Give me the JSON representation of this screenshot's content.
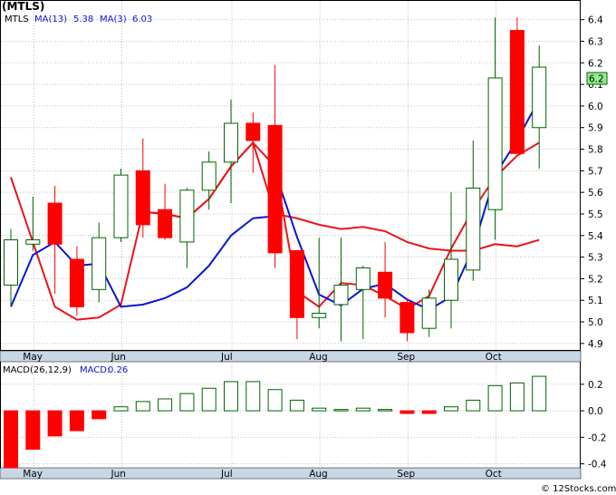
{
  "header": {
    "ticker": "(MTLS)"
  },
  "legend": {
    "symbol": "MTLS",
    "ma13_label": "MA(13)",
    "ma13_value": "5.38",
    "ma3_label": "MA(3)",
    "ma3_value": "6.03",
    "macd_params": "MACD(26,12,9)",
    "macd_label": "MACD:",
    "macd_value": "0.26"
  },
  "last_price_tag": "6.2",
  "credit": "© 12Stocks.com",
  "colors": {
    "up": "#006400",
    "down": "#ff0000",
    "ma13": "#e8151b",
    "ma3": "#0a14d2",
    "axis_band": "#c8d7e6",
    "price_tag": "#90ee90"
  },
  "chart_data": {
    "type": "candlestick",
    "timeframe": "weekly",
    "price_axis": {
      "ylim": [
        4.87,
        6.47
      ],
      "ticks": [
        "4.9",
        "5.0",
        "5.1",
        "5.2",
        "5.3",
        "5.4",
        "5.5",
        "5.6",
        "5.7",
        "5.8",
        "5.9",
        "6.0",
        "6.1",
        "6.2",
        "6.3",
        "6.4"
      ]
    },
    "macd_axis": {
      "ylim": [
        -0.43,
        0.37
      ],
      "ticks": [
        "0.2",
        "0.0",
        "-0.2",
        "-0.4"
      ]
    },
    "months": [
      "May",
      "Jun",
      "Jul",
      "Aug",
      "Sep",
      "Oct"
    ],
    "month_week_index": [
      1,
      5,
      10,
      14,
      18,
      22
    ],
    "candles": [
      {
        "o": 5.17,
        "h": 5.43,
        "l": 5.08,
        "c": 5.38
      },
      {
        "o": 5.36,
        "h": 5.58,
        "l": 5.33,
        "c": 5.38
      },
      {
        "o": 5.55,
        "h": 5.63,
        "l": 5.13,
        "c": 5.36
      },
      {
        "o": 5.29,
        "h": 5.35,
        "l": 5.03,
        "c": 5.07
      },
      {
        "o": 5.15,
        "h": 5.46,
        "l": 5.09,
        "c": 5.39
      },
      {
        "o": 5.39,
        "h": 5.71,
        "l": 5.37,
        "c": 5.68
      },
      {
        "o": 5.7,
        "h": 5.85,
        "l": 5.39,
        "c": 5.45
      },
      {
        "o": 5.52,
        "h": 5.64,
        "l": 5.38,
        "c": 5.39
      },
      {
        "o": 5.37,
        "h": 5.62,
        "l": 5.25,
        "c": 5.61
      },
      {
        "o": 5.61,
        "h": 5.79,
        "l": 5.52,
        "c": 5.74
      },
      {
        "o": 5.74,
        "h": 6.03,
        "l": 5.55,
        "c": 5.92
      },
      {
        "o": 5.92,
        "h": 5.97,
        "l": 5.69,
        "c": 5.84
      },
      {
        "o": 5.91,
        "h": 6.19,
        "l": 5.25,
        "c": 5.32
      },
      {
        "o": 5.33,
        "h": 5.33,
        "l": 4.92,
        "c": 5.02
      },
      {
        "o": 5.02,
        "h": 5.39,
        "l": 4.97,
        "c": 5.04
      },
      {
        "o": 5.08,
        "h": 5.39,
        "l": 4.91,
        "c": 5.17
      },
      {
        "o": 5.15,
        "h": 5.26,
        "l": 4.92,
        "c": 5.25
      },
      {
        "o": 5.23,
        "h": 5.37,
        "l": 5.02,
        "c": 5.11
      },
      {
        "o": 5.09,
        "h": 5.11,
        "l": 4.91,
        "c": 4.95
      },
      {
        "o": 4.97,
        "h": 5.15,
        "l": 4.93,
        "c": 5.11
      },
      {
        "o": 5.1,
        "h": 5.6,
        "l": 4.97,
        "c": 5.29
      },
      {
        "o": 5.24,
        "h": 5.84,
        "l": 5.19,
        "c": 5.62
      },
      {
        "o": 5.52,
        "h": 6.41,
        "l": 5.38,
        "c": 6.13
      },
      {
        "o": 6.35,
        "h": 6.41,
        "l": 5.79,
        "c": 5.78
      },
      {
        "o": 5.9,
        "h": 6.28,
        "l": 5.71,
        "c": 6.18
      }
    ],
    "ma13": [
      5.67,
      5.37,
      5.07,
      5.01,
      5.02,
      5.08,
      5.51,
      5.5,
      5.48,
      5.57,
      5.72,
      5.83,
      5.72,
      5.14,
      5.07,
      5.18,
      5.17,
      5.12,
      5.06,
      5.12,
      5.34,
      5.52,
      5.67,
      5.77,
      5.83
    ],
    "ma3": [
      5.07,
      5.31,
      5.37,
      5.26,
      5.27,
      5.37,
      5.51,
      null,
      null,
      null,
      null,
      null,
      null,
      null,
      null,
      null,
      null,
      null,
      null,
      null,
      null,
      null,
      null,
      null,
      null
    ],
    "ma13_line": [
      null,
      null,
      null,
      null,
      null,
      null,
      5.51,
      5.5,
      5.48,
      5.57,
      5.72,
      5.83,
      5.5,
      5.48,
      5.45,
      5.43,
      5.44,
      5.42,
      5.37,
      5.34,
      5.33,
      5.33,
      5.36,
      5.35,
      5.38
    ],
    "ma3_line": [
      5.07,
      5.31,
      5.37,
      5.26,
      5.27,
      5.07,
      5.08,
      5.11,
      5.16,
      5.26,
      5.4,
      5.48,
      5.49,
      null,
      null,
      null,
      null,
      null,
      null,
      null,
      null,
      null,
      null,
      null,
      null
    ],
    "macd": [
      -0.43,
      -0.29,
      -0.19,
      -0.15,
      -0.06,
      0.03,
      0.07,
      0.09,
      0.13,
      0.17,
      0.22,
      0.22,
      0.16,
      0.08,
      0.02,
      0.01,
      0.02,
      0.01,
      -0.02,
      -0.02,
      0.03,
      0.08,
      0.19,
      0.21,
      0.26
    ]
  }
}
